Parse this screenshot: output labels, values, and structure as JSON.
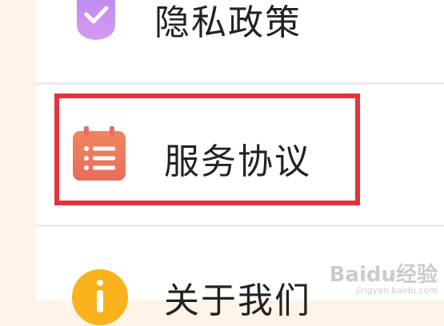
{
  "menu": {
    "items": [
      {
        "label": "隐私政策",
        "icon": "check-shield-icon",
        "color": "#c38ef0"
      },
      {
        "label": "服务协议",
        "icon": "document-list-icon",
        "color": "#ec7a5f"
      },
      {
        "label": "关于我们",
        "icon": "info-icon",
        "color": "#f7b21c"
      }
    ]
  },
  "highlight_color": "#e8313a",
  "watermark": {
    "brand": "Baidu经验",
    "url": "jingyan.baidu.com"
  }
}
